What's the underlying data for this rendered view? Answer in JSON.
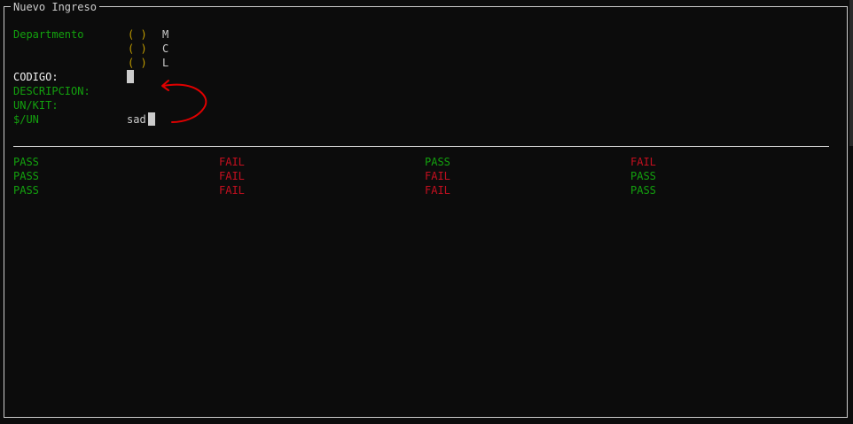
{
  "window": {
    "title": "Nuevo Ingreso"
  },
  "form": {
    "department_label": "Departmento",
    "departments": [
      {
        "marker": "( )",
        "label": "M"
      },
      {
        "marker": "( )",
        "label": "C"
      },
      {
        "marker": "( )",
        "label": "L"
      }
    ],
    "fields": [
      {
        "label": "CODIGO:",
        "value": ""
      },
      {
        "label": "DESCRIPCION:",
        "value": ""
      },
      {
        "label": "UN/KIT:",
        "value": ""
      },
      {
        "label": "$/UN",
        "value": "sad"
      }
    ]
  },
  "results": {
    "columns": [
      [
        "PASS",
        "PASS",
        "PASS"
      ],
      [
        "FAIL",
        "FAIL",
        "FAIL"
      ],
      [
        "PASS",
        "FAIL",
        "FAIL"
      ],
      [
        "FAIL",
        "PASS",
        "PASS"
      ]
    ]
  },
  "colors": {
    "background": "#0c0c0c",
    "label_green": "#13a10e",
    "active_white": "#f2f2f2",
    "radio_orange": "#c19c00",
    "fail_red": "#c50f1f",
    "pass_green": "#13a10e",
    "annotation_red": "#e00000"
  }
}
